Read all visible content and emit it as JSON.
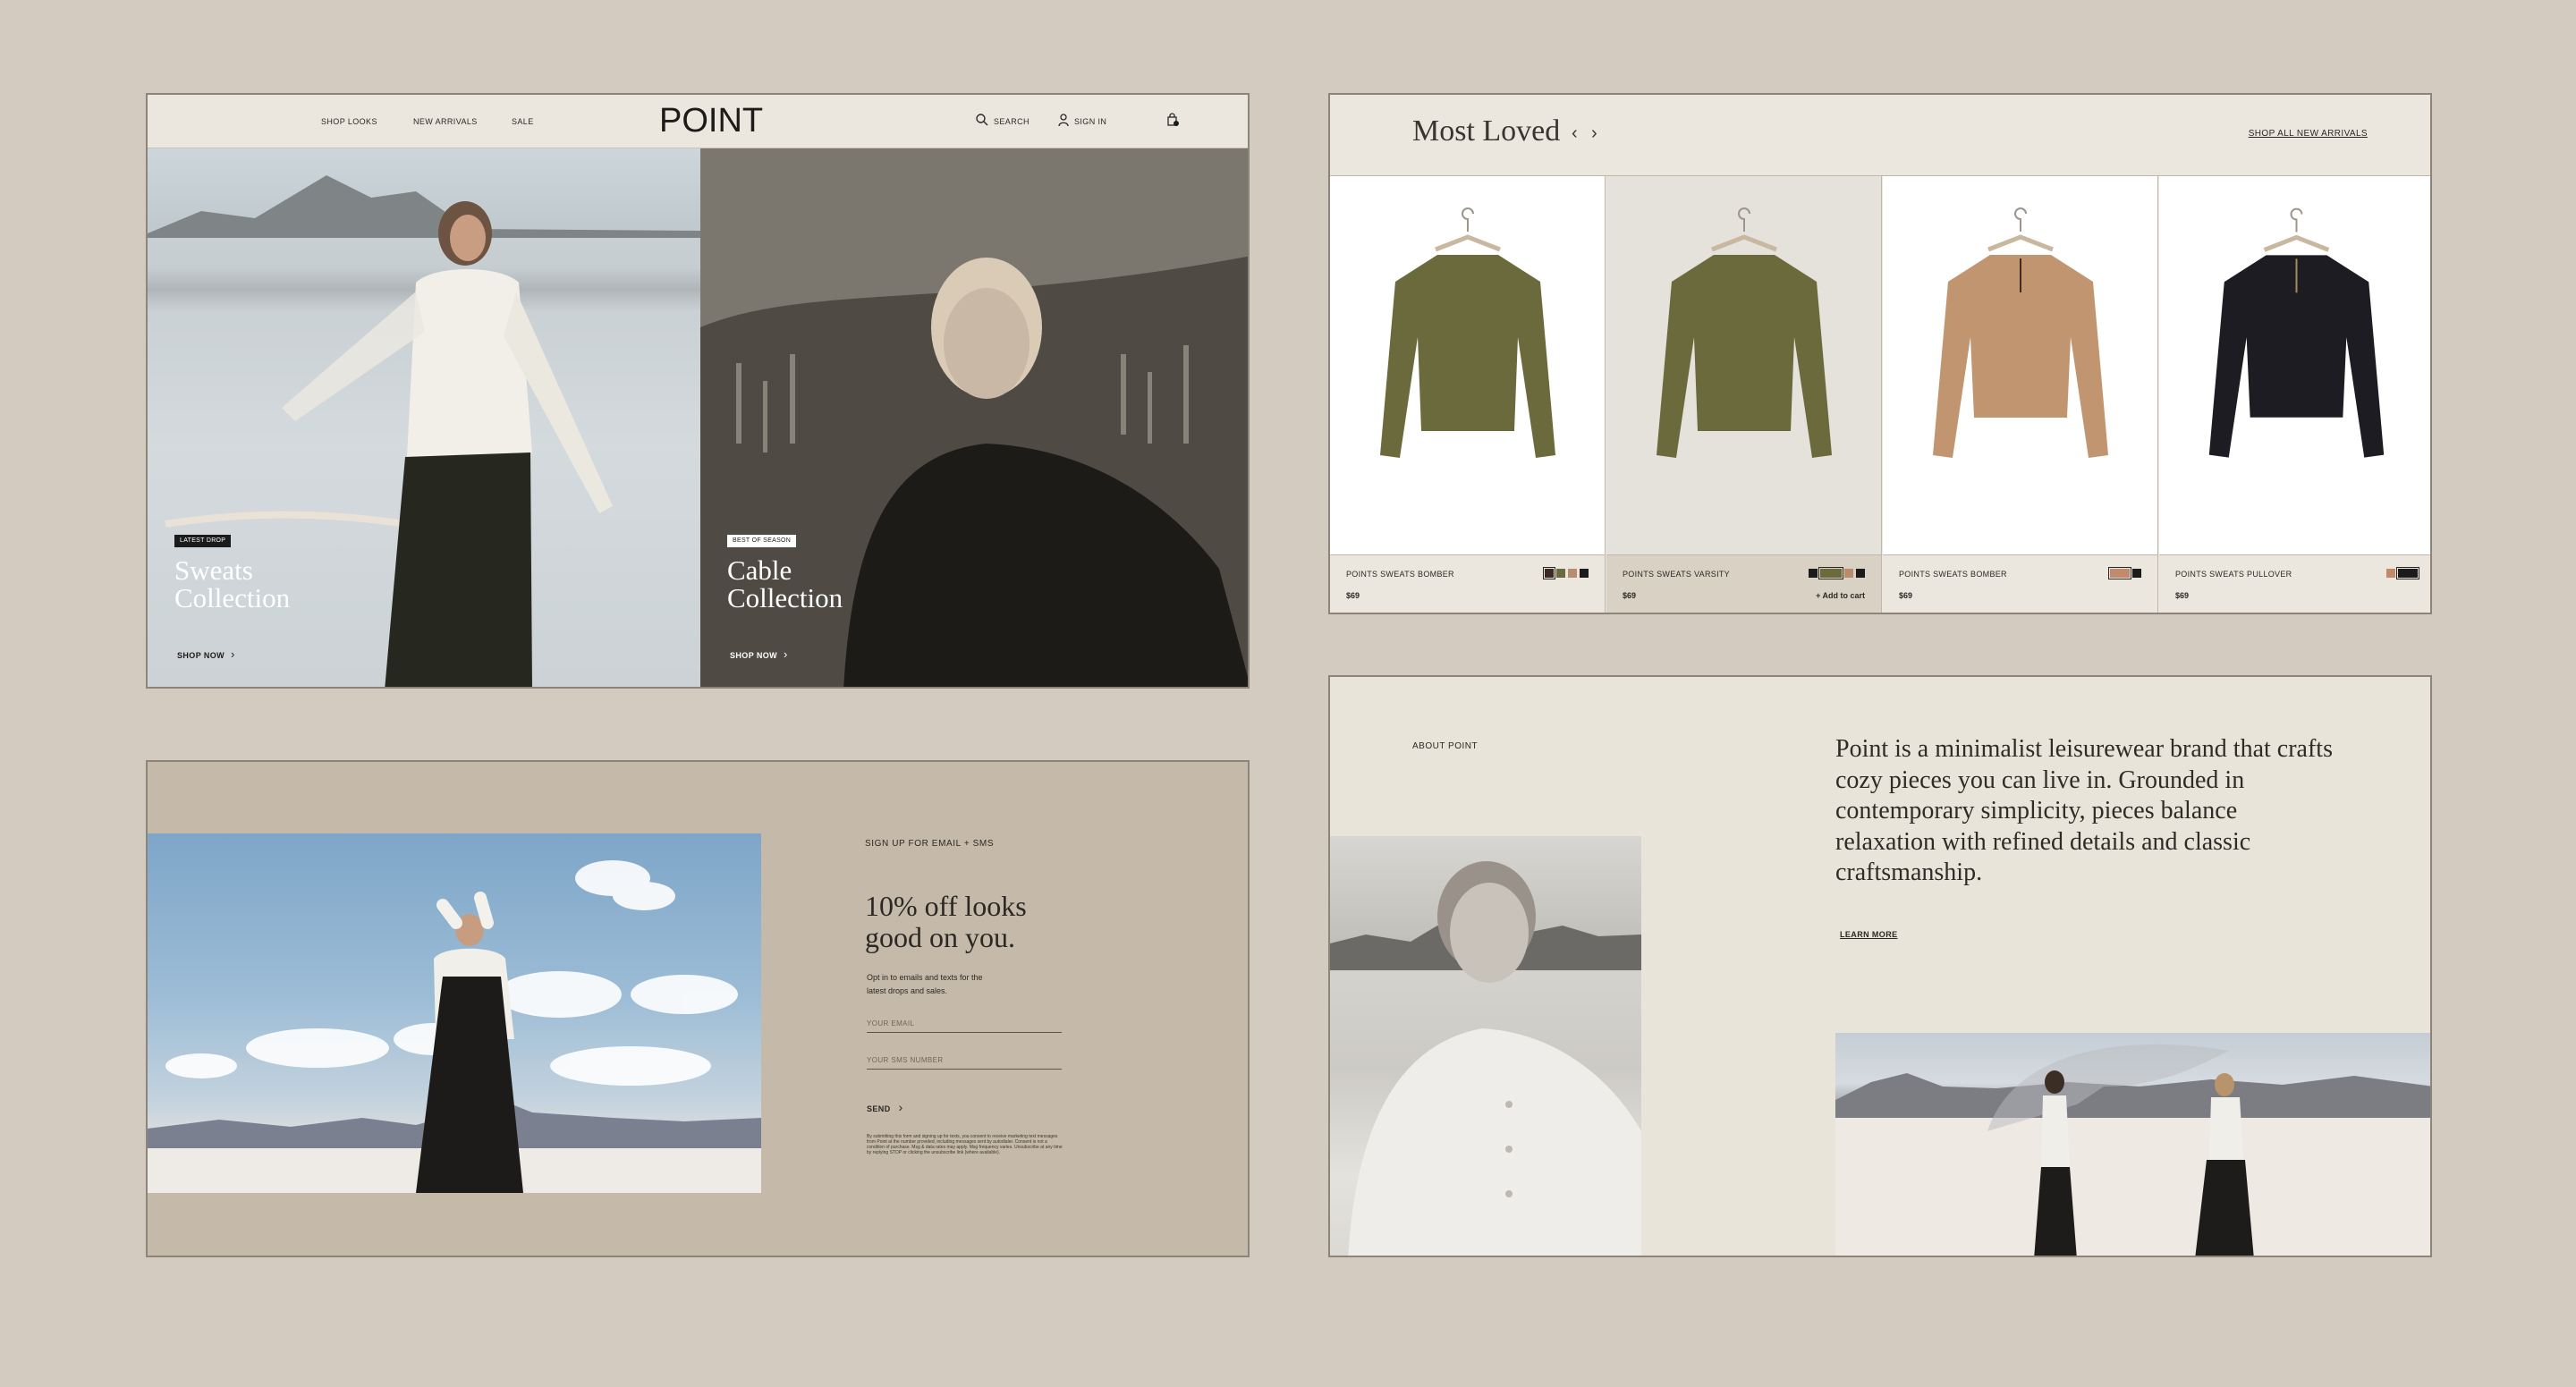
{
  "hero": {
    "nav": {
      "links": [
        "SHOP LOOKS",
        "NEW ARRIVALS",
        "SALE"
      ],
      "logo": "POINT",
      "search_label": "SEARCH",
      "signin_label": "SIGN IN",
      "icons": [
        "search-icon",
        "user-icon",
        "bag-icon"
      ]
    },
    "left": {
      "badge": "LATEST DROP",
      "title_line1": "Sweats",
      "title_line2": "Collection",
      "cta": "SHOP NOW"
    },
    "right": {
      "badge": "BEST OF SEASON",
      "title_line1": "Cable",
      "title_line2": "Collection",
      "cta": "SHOP NOW"
    }
  },
  "most_loved": {
    "title": "Most Loved",
    "prev_icon": "chevron-left-icon",
    "next_icon": "chevron-right-icon",
    "shop_all": "SHOP ALL NEW ARRIVALS",
    "products": [
      {
        "name": "POINTS SWEATS BOMBER",
        "price": "$69",
        "color": "#6b6a3c",
        "swatches": [
          "#3a2a22",
          "#6b6a3c",
          "#b98c6e",
          "#1b1b1b"
        ]
      },
      {
        "name": "POINTS SWEATS VARSITY",
        "price": "$69",
        "add_to_cart": "+ Add to cart",
        "color": "#6b6a3c",
        "swatches": [
          "#1b1b1b",
          "#6b6a3c",
          "#b98c6e",
          "#1b1b1b"
        ]
      },
      {
        "name": "POINTS SWEATS BOMBER",
        "price": "$69",
        "color": "#c29571",
        "swatches": [
          "#c28a6c",
          "#1b1b1b"
        ]
      },
      {
        "name": "POINTS SWEATS PULLOVER",
        "price": "$69",
        "color": "#1c1c22",
        "swatches": [
          "#c28a6c",
          "#1b1b1b"
        ]
      }
    ]
  },
  "signup": {
    "eyebrow": "SIGN UP FOR EMAIL + SMS",
    "title_line1": "10% off looks",
    "title_line2": "good on you.",
    "body": "Opt in to emails and texts for the latest drops and sales.",
    "email_placeholder": "YOUR EMAIL",
    "phone_placeholder": "YOUR SMS NUMBER",
    "send": "SEND",
    "legal": "By submitting this form and signing up for texts, you consent to receive marketing text messages from Point at the number provided, including messages sent by autodialer. Consent is not a condition of purchase. Msg & data rates may apply. Msg frequency varies. Unsubscribe at any time by replying STOP or clicking the unsubscribe link (where available)."
  },
  "about": {
    "eyebrow": "ABOUT POINT",
    "text": "Point is a minimalist leisurewear brand that crafts cozy pieces you can live in. Grounded in contemporary simplicity, pieces balance relaxation with refined details and classic craftsmanship.",
    "learn_more": "LEARN MORE"
  }
}
